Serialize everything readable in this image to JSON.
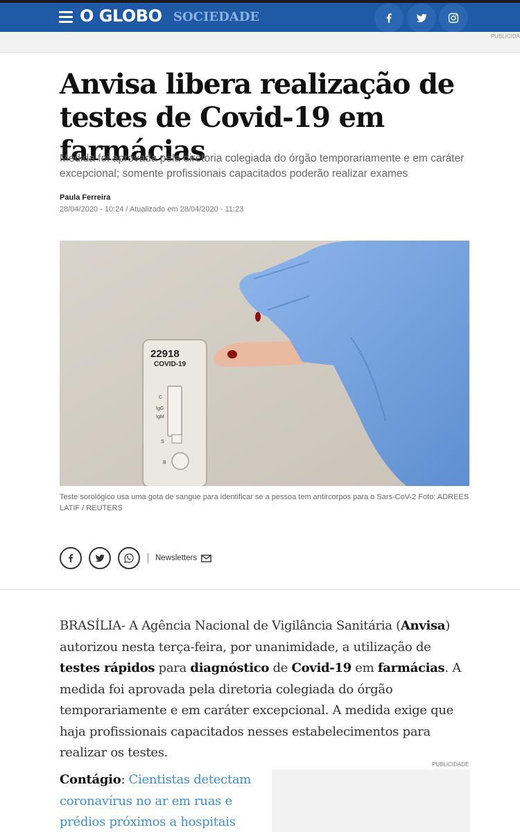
{
  "header": {
    "logo": "O GLOBO",
    "section": "SOCIEDADE",
    "social_icons": [
      "facebook-icon",
      "twitter-icon",
      "instagram-icon"
    ]
  },
  "ad_top": {
    "label": "PUBLICIDA"
  },
  "article": {
    "headline": "Anvisa libera realização de testes de Covid-19 em farmácias",
    "subtitle": "Medida foi aprovada pela diretoria colegiada do órgão temporariamente e em caráter excepcional; somente profissionais capacitados poderão realizar exames",
    "author": "Paula Ferreira",
    "dateline": "28/04/2020 - 10:24 / Atualizado em 28/04/2020 - 11:23",
    "photo": {
      "test_label_number": "22918",
      "test_label_text": "COVID-19",
      "marks": [
        "C",
        "IgG",
        "IgM",
        "S",
        "B"
      ]
    },
    "caption": "Teste sorológico usa uma gota de sangue para identificar se a pessoa tem antircorpos para o Sars-CoV-2 Foto: ADREES LATIF / REUTERS"
  },
  "share": {
    "buttons": [
      "facebook-icon",
      "twitter-icon",
      "whatsapp-icon"
    ],
    "newsletter_label": "Newsletters"
  },
  "body": {
    "p1": [
      "BRASÍLIA- A Agência Nacional de Vigilância Sanitária (",
      "Anvisa",
      ") autorizou nesta terça-feira, por unanimidade, a utilização  de ",
      "testes rápidos",
      " para ",
      "diagnóstico",
      " de ",
      "Covid-19",
      " em ",
      "farmácias",
      ". A medida foi aprovada pela diretoria colegiada do órgão temporariamente e em caráter excepcional. A medida exige que haja profissionais capacitados nesses estabelecimentos para realizar os testes."
    ]
  },
  "related": {
    "label": "Contágio",
    "sep": ": ",
    "link_text": "Cientistas detectam coronavírus no ar em ruas e prédios próximos a hospitais"
  },
  "ad_side": {
    "label": "PUBLICIDADE"
  },
  "colors": {
    "header_blue": "#1f5aa7",
    "link_blue": "#3a8fd6"
  }
}
